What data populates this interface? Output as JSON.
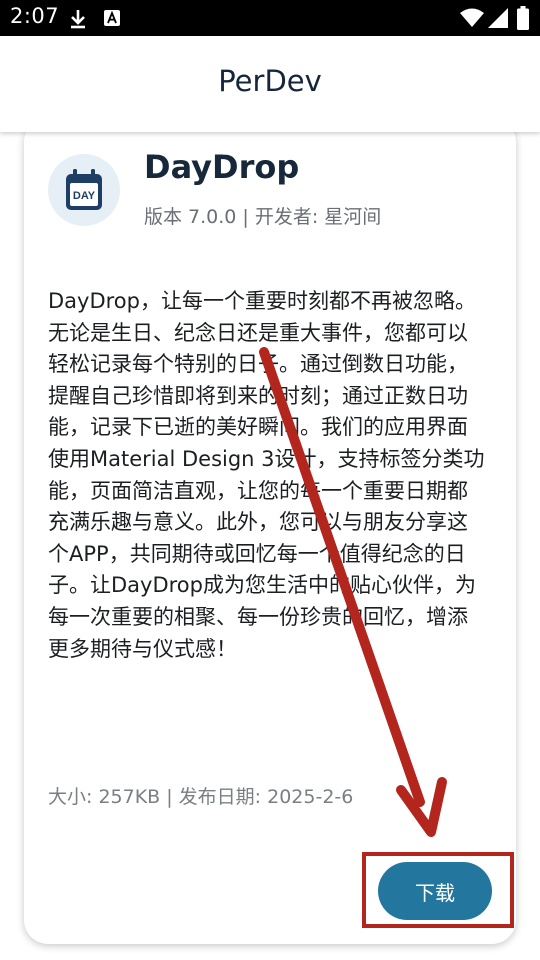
{
  "status_bar": {
    "time": "2:07",
    "icons": [
      "download-icon",
      "a-badge-icon",
      "wifi-icon",
      "signal-icon",
      "battery-icon"
    ]
  },
  "app_bar": {
    "title": "PerDev"
  },
  "app": {
    "icon_name": "calendar-icon",
    "icon_label": "DAY",
    "name": "DayDrop",
    "meta": "版本 7.0.0 | 开发者: 星河间",
    "description": "DayDrop，让每一个重要时刻都不再被忽略。无论是生日、纪念日还是重大事件，您都可以轻松记录每个特别的日子。通过倒数日功能，提醒自己珍惜即将到来的时刻；通过正数日功能，记录下已逝的美好瞬间。我们的应用界面使用Material Design 3设计，支持标签分类功能，页面简洁直观，让您的每一个重要日期都充满乐趣与意义。此外，您可以与朋友分享这个APP，共同期待或回忆每一个值得纪念的日子。让DayDrop成为您生活中的贴心伙伴，为每一次重要的相聚、每一份珍贵的回忆，增添更多期待与仪式感！",
    "size_date": "大小: 257KB | 发布日期: 2025-2-6"
  },
  "actions": {
    "download_label": "下载"
  },
  "colors": {
    "primary": "#23779f",
    "annotation": "#b3261e",
    "title_text": "#16263a"
  }
}
